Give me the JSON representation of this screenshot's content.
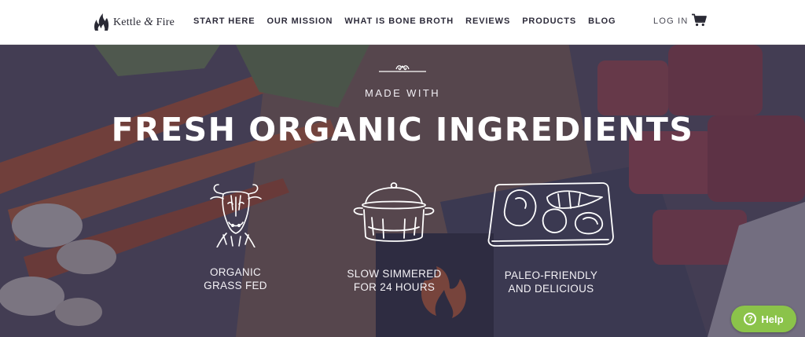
{
  "brand": {
    "name_left": "Kettle ",
    "name_amp": "&",
    "name_right": " Fire",
    "logo_icon": "flame-logo-icon"
  },
  "nav": {
    "items": [
      "START HERE",
      "OUR MISSION",
      "WHAT IS BONE BROTH",
      "REVIEWS",
      "PRODUCTS",
      "BLOG"
    ]
  },
  "account": {
    "login_label": "LOG IN",
    "cart_icon": "cart-icon"
  },
  "hero": {
    "eyebrow": "MADE WITH",
    "headline": "FRESH ORGANIC INGREDIENTS",
    "features": [
      {
        "icon": "cow-icon",
        "line1": "ORGANIC",
        "line2": "GRASS FED"
      },
      {
        "icon": "pot-icon",
        "line1": "SLOW SIMMERED",
        "line2": "FOR 24 HOURS"
      },
      {
        "icon": "vegetable-board-icon",
        "line1": "PALEO-FRIENDLY",
        "line2": "AND DELICIOUS"
      }
    ]
  },
  "help": {
    "label": "Help",
    "icon": "question-icon",
    "color": "#8bc34a"
  },
  "colors": {
    "overlay": "#302c48",
    "nav_text": "#2d2b3a"
  }
}
